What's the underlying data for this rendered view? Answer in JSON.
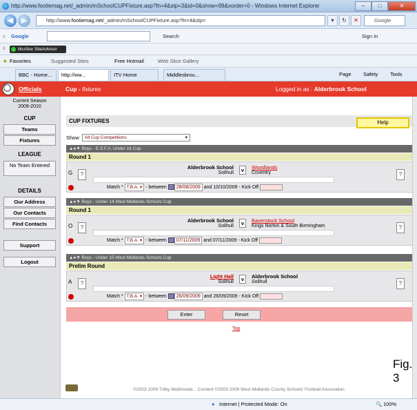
{
  "window": {
    "title": "http://www.footiemag.net/_admin/mSchoolCUPFixture.asp?fn=4&stp=3&id=0&show=99&xorder=0 - Windows Internet Explorer"
  },
  "address": {
    "pre": "http://www.",
    "host": "footiemag.net",
    "path": "/_admin/mSchoolCUPFixture.asp?fn=4&stp=",
    "search_engine": "Google"
  },
  "google_toolbar": {
    "label": "Google",
    "search_label": "Search",
    "signin_label": "Sign In"
  },
  "mcafee": {
    "label": "McAfee SiteAdvisor"
  },
  "favorites": {
    "label": "Favorites",
    "items": [
      "Suggested Sites",
      "Free Hotmail",
      "Web Slice Gallery"
    ]
  },
  "tabs": [
    {
      "label": "BBC - Home..."
    },
    {
      "label": "http://ww..."
    },
    {
      "label": "ITV Home"
    },
    {
      "label": "Middlesbrou..."
    }
  ],
  "cmdbar": {
    "page": "Page",
    "safety": "Safety",
    "tools": "Tools"
  },
  "header": {
    "link": "Officials",
    "section": "Cup",
    "subsection": "fixtures",
    "logged_label": "Logged in as :",
    "logged_user": "Alderbrook School"
  },
  "sidebar": {
    "season_label": "Current Season",
    "season": "2009-2010",
    "cup_heading": "CUP",
    "teams": "Teams",
    "fixtures": "Fixtures",
    "league_heading": "LEAGUE",
    "no_team": "No Team Entered",
    "details_heading": "DETAILS",
    "our_address": "Our Address",
    "our_contacts": "Our Contacts",
    "find_contacts": "Find Contacts",
    "support": "Support",
    "logout": "Logout"
  },
  "main": {
    "title": "CUP FIXTURES",
    "help": "Help",
    "show_label": "Show",
    "show_value": "All Cup Competitions",
    "enter": "Enter",
    "reset": "Reset",
    "top": "Top"
  },
  "fixtures": [
    {
      "competition": "Boys - E.S.F.A. Under 16 Cup",
      "round": "Round 1",
      "letter": "G",
      "home": "Alderbrook School",
      "home_sub": "Solihull",
      "away": "Woodlands",
      "away_sub": "Coventry",
      "match_status": "T.B.A.",
      "date_from": "28/08/2009",
      "date_to": "10/10/2009"
    },
    {
      "competition": "Boys - Under 14 West Midlands Schools Cup",
      "round": "Round 1",
      "letter": "O",
      "home": "Alderbrook School",
      "home_sub": "Solihull",
      "away": "Baverstock School",
      "away_sub": "Kings Norton & South Birmingham",
      "match_status": "T.B.A.",
      "date_from": "07/11/2009",
      "date_to": "07/11/2009"
    },
    {
      "competition": "Boys - Under 15 West Midlands Schools Cup",
      "round": "Prelim Round",
      "letter": "A",
      "home": "Light Hall",
      "home_sub": "Solihull",
      "away": "Alderbrook School",
      "away_sub": "Solihull",
      "match_status": "T.B.A.",
      "date_from": "26/09/2009",
      "date_to": "26/09/2009"
    }
  ],
  "labels": {
    "match": "Match",
    "between": "between",
    "and": "and",
    "kickoff": "- Kick Off",
    "v": "v",
    "arrows": "▲●▼"
  },
  "figure_label": "Fig. 3",
  "copyright": "©2003-2009 Trilby Multimedia :: Content ©2003-2009 West Midlands County Schools' Football Association",
  "status": {
    "zone": "Internet | Protected Mode: On",
    "zoom": "100%"
  }
}
